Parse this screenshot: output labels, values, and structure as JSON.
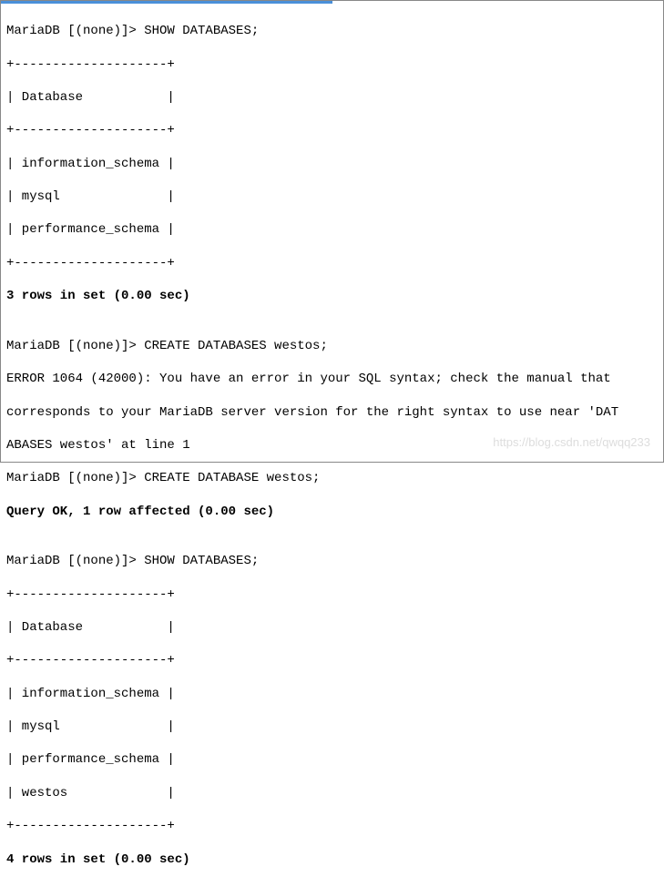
{
  "topbar": {},
  "lines": {
    "l1": "MariaDB [(none)]> SHOW DATABASES;",
    "l2": "+--------------------+",
    "l3": "| Database           |",
    "l4": "+--------------------+",
    "l5": "| information_schema |",
    "l6": "| mysql              |",
    "l7": "| performance_schema |",
    "l8": "+--------------------+",
    "l9": "3 rows in set (0.00 sec)",
    "l10": "",
    "l11": "MariaDB [(none)]> CREATE DATABASES westos;",
    "l12": "ERROR 1064 (42000): You have an error in your SQL syntax; check the manual that ",
    "l13": "corresponds to your MariaDB server version for the right syntax to use near 'DAT",
    "l14": "ABASES westos' at line 1",
    "l15": "MariaDB [(none)]> CREATE DATABASE westos;",
    "l16": "Query OK, 1 row affected (0.00 sec)",
    "l17": "",
    "l18": "MariaDB [(none)]> SHOW DATABASES;",
    "l19": "+--------------------+",
    "l20": "| Database           |",
    "l21": "+--------------------+",
    "l22": "| information_schema |",
    "l23": "| mysql              |",
    "l24": "| performance_schema |",
    "l25": "| westos             |",
    "l26": "+--------------------+",
    "l27": "4 rows in set (0.00 sec)"
  },
  "watermark": "https://blog.csdn.net/qwqq233"
}
